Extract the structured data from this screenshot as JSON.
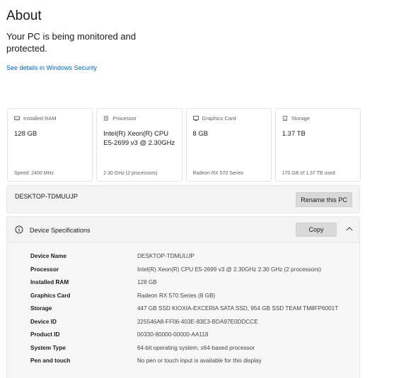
{
  "page": {
    "title": "About",
    "monitor_text": "Your PC is being monitored and protected.",
    "security_link": "See details in Windows Security"
  },
  "cards": [
    {
      "icon": "ram-icon",
      "label": "Installed RAM",
      "value": "128 GB",
      "sub": "Speed: 2400 MHz"
    },
    {
      "icon": "processor-icon",
      "label": "Processor",
      "value": "Intel(R) Xeon(R) CPU E5-2699 v3 @ 2.30GHz",
      "sub": "2.30 GHz (2 processors)"
    },
    {
      "icon": "graphics-card-icon",
      "label": "Graphics Card",
      "value": "8 GB",
      "sub": "Radeon RX 570 Series"
    },
    {
      "icon": "storage-icon",
      "label": "Storage",
      "value": "1.37 TB",
      "sub": "170 GB of 1.37 TB used"
    }
  ],
  "pc": {
    "name": "DESKTOP-TDMUUJP",
    "rename_label": "Rename this PC"
  },
  "specs": {
    "title": "Device Specifications",
    "copy_label": "Copy",
    "rows": [
      {
        "label": "Device Name",
        "value": "DESKTOP-TDMUUJP"
      },
      {
        "label": "Processor",
        "value": "Intel(R) Xeon(R) CPU E5-2699 v3 @ 2.30GHz   2.30 GHz  (2 processors)"
      },
      {
        "label": "Installed RAM",
        "value": "128 GB"
      },
      {
        "label": "Graphics Card",
        "value": "Radeon RX 570 Series (8 GB)"
      },
      {
        "label": "Storage",
        "value": "447 GB SSD KIOXIA-EXCERIA SATA SSD, 954 GB SSD TEAM TM8FP6001T"
      },
      {
        "label": "Device ID",
        "value": "225546A8-FF06-403E-83E3-BDA97E0DDCCE"
      },
      {
        "label": "Product ID",
        "value": "00330-80000-00000-AA118"
      },
      {
        "label": "System Type",
        "value": "64-bit operating system, x64-based processor"
      },
      {
        "label": "Pen and touch",
        "value": "No pen or touch input is available for this display"
      }
    ]
  },
  "colors": {
    "link": "#0067c0",
    "panel_bg": "#f3f3f3",
    "button_bg": "#d9d9d9"
  }
}
